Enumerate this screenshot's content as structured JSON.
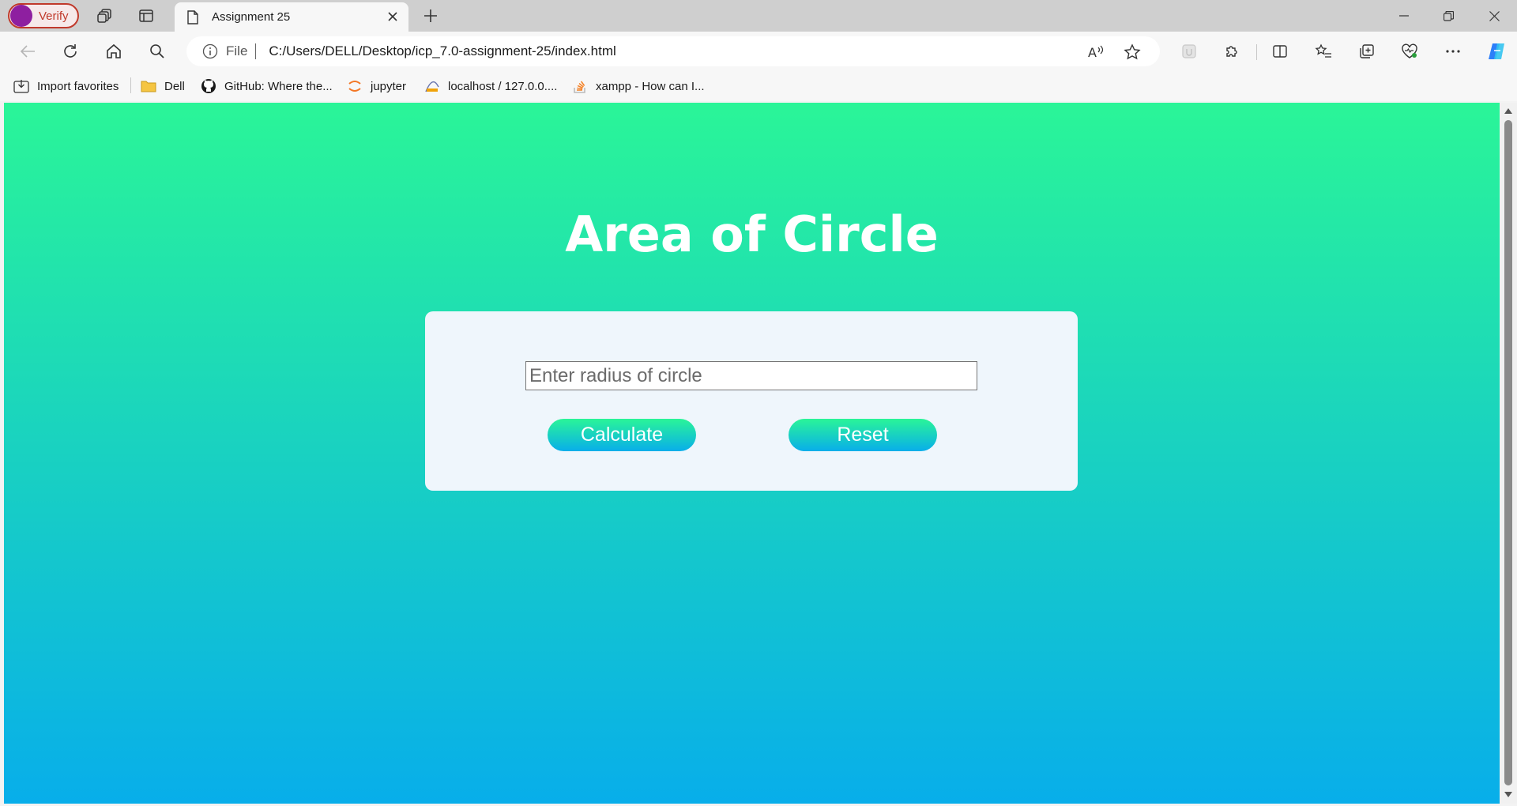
{
  "profile": {
    "verify_label": "Verify",
    "avatar_color": "#8e1fa0"
  },
  "tab": {
    "title": "Assignment 25"
  },
  "address": {
    "scheme": "File",
    "url": "C:/Users/DELL/Desktop/icp_7.0-assignment-25/index.html"
  },
  "favorites": [
    {
      "label": "Import favorites",
      "icon": "import-favorites-icon"
    },
    {
      "label": "Dell",
      "icon": "folder-icon"
    },
    {
      "label": "GitHub: Where the...",
      "icon": "github-icon"
    },
    {
      "label": "jupyter",
      "icon": "jupyter-icon"
    },
    {
      "label": "localhost / 127.0.0....",
      "icon": "phpmyadmin-icon"
    },
    {
      "label": "xampp - How can I...",
      "icon": "stackoverflow-icon"
    }
  ],
  "page": {
    "title": "Area of Circle",
    "input_placeholder": "Enter radius of circle",
    "input_value": "",
    "calculate_label": "Calculate",
    "reset_label": "Reset"
  },
  "colors": {
    "gradient_top": "#2af598",
    "gradient_bottom": "#08aeea",
    "card_bg": "#eff6fc"
  }
}
